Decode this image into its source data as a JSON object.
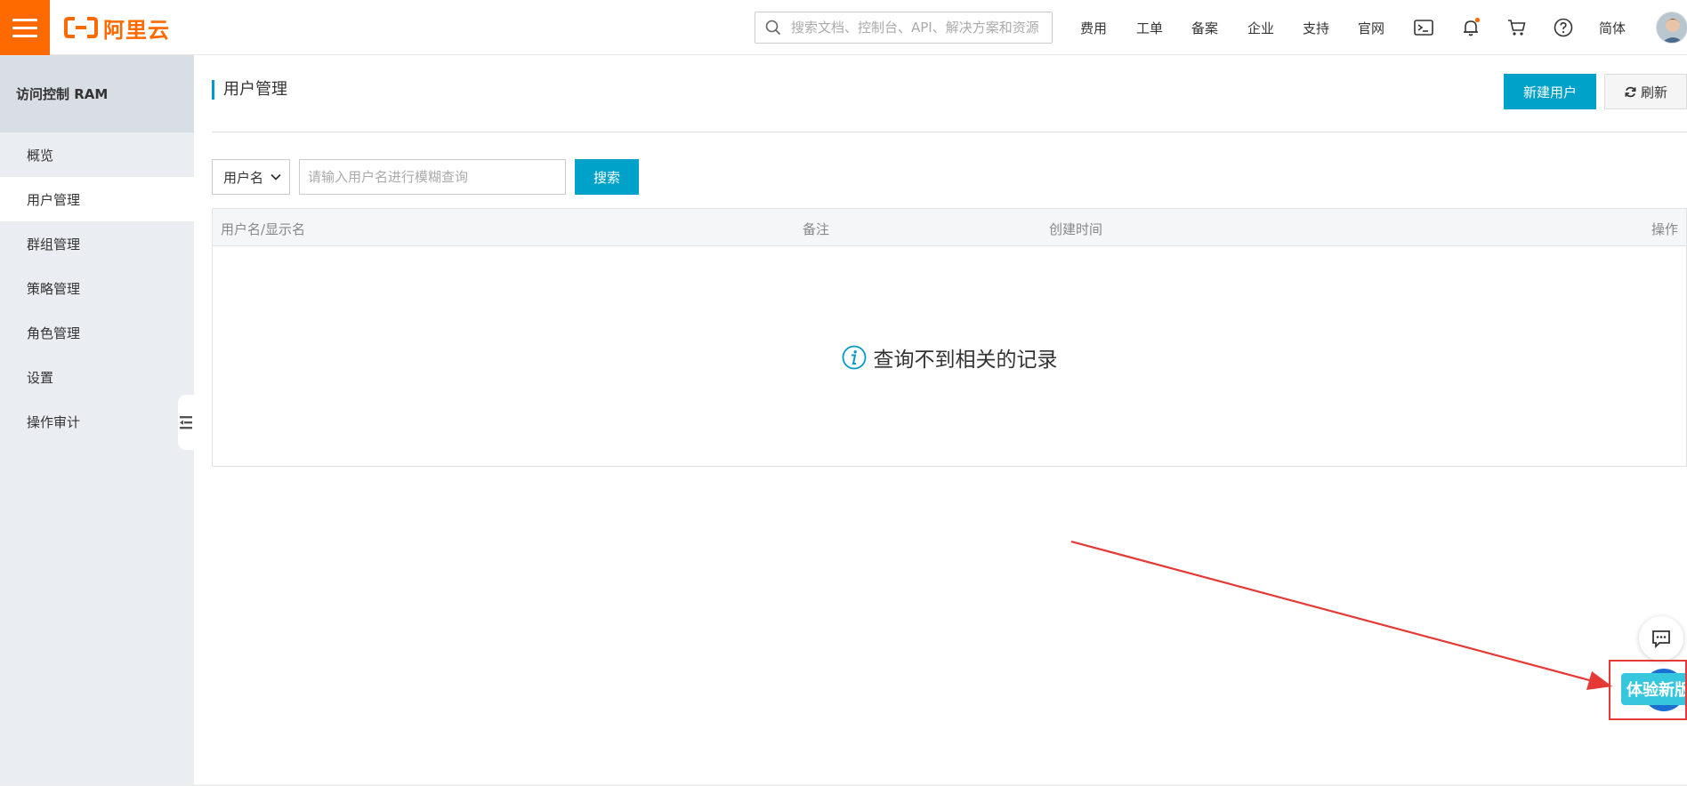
{
  "brand": {
    "logo_text": "阿里云",
    "accent": "#ff6a00",
    "primary": "#00a2ca"
  },
  "header": {
    "search_placeholder": "搜索文档、控制台、API、解决方案和资源",
    "nav": [
      "费用",
      "工单",
      "备案",
      "企业",
      "支持",
      "官网"
    ],
    "lang": "简体",
    "icons": [
      "terminal-icon",
      "bell-icon",
      "cart-icon",
      "help-icon"
    ]
  },
  "sidebar": {
    "title": "访问控制 RAM",
    "items": [
      {
        "label": "概览"
      },
      {
        "label": "用户管理"
      },
      {
        "label": "群组管理"
      },
      {
        "label": "策略管理"
      },
      {
        "label": "角色管理"
      },
      {
        "label": "设置"
      },
      {
        "label": "操作审计"
      }
    ]
  },
  "main": {
    "title": "用户管理",
    "new_user_label": "新建用户",
    "refresh_label": "刷新",
    "filter": {
      "selected": "用户名",
      "placeholder": "请输入用户名进行模糊查询",
      "search_label": "搜索"
    },
    "table": {
      "columns": [
        "用户名/显示名",
        "备注",
        "创建时间",
        "操作"
      ],
      "empty_text": "查询不到相关的记录"
    }
  },
  "float": {
    "new_version_label": "体验新版"
  }
}
